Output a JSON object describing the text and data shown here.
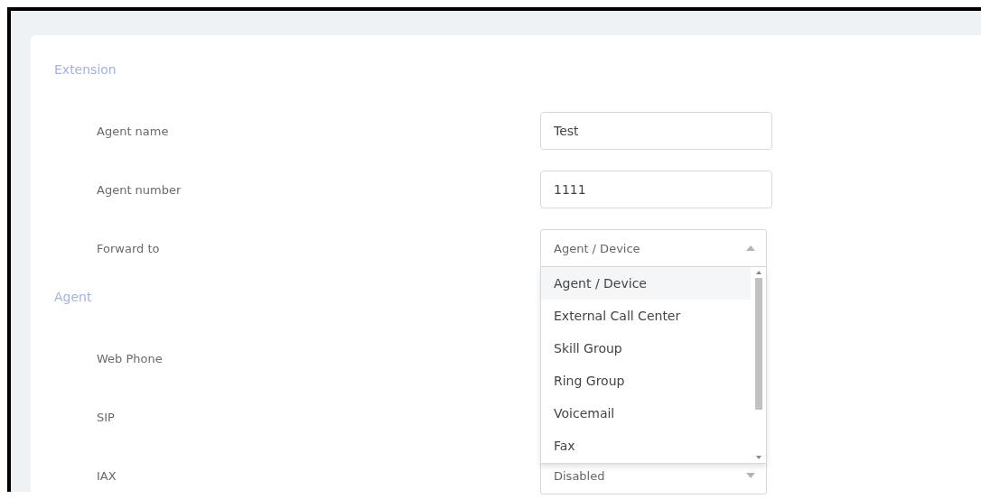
{
  "sections": [
    {
      "title": "Extension",
      "rows": [
        {
          "label": "Agent name",
          "control": {
            "kind": "input",
            "value": "Test"
          }
        },
        {
          "label": "Agent number",
          "control": {
            "kind": "input",
            "value": "1111"
          }
        },
        {
          "label": "Forward to",
          "control": {
            "kind": "select",
            "value": "Agent / Device",
            "expanded": true,
            "options": [
              {
                "label": "Agent / Device",
                "selected": true
              },
              {
                "label": "External Call Center",
                "selected": false
              },
              {
                "label": "Skill Group",
                "selected": false
              },
              {
                "label": "Ring Group",
                "selected": false
              },
              {
                "label": "Voicemail",
                "selected": false
              },
              {
                "label": "Fax",
                "selected": false
              }
            ]
          }
        }
      ]
    },
    {
      "title": "Agent",
      "rows": [
        {
          "label": "Web Phone"
        },
        {
          "label": "SIP"
        },
        {
          "label": "IAX",
          "control": {
            "kind": "select",
            "value": "Disabled",
            "expanded": false
          }
        }
      ]
    }
  ]
}
